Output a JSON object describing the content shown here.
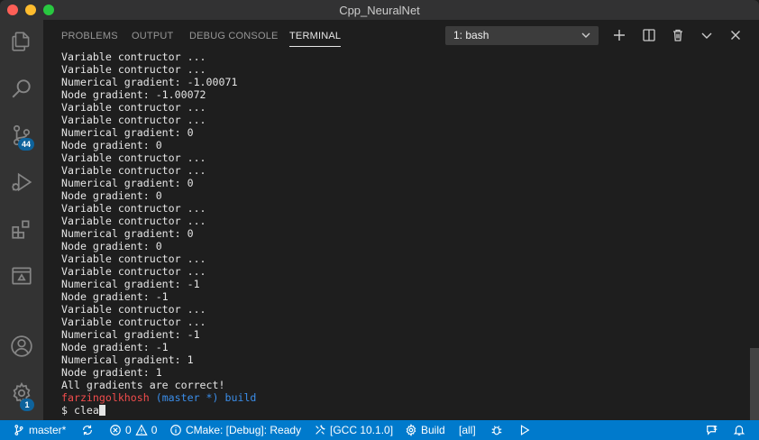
{
  "window": {
    "title": "Cpp_NeuralNet"
  },
  "activity_bar": {
    "items": [
      {
        "icon": "files-icon"
      },
      {
        "icon": "search-icon"
      },
      {
        "icon": "source-control-icon",
        "badge": "44"
      },
      {
        "icon": "run-debug-icon"
      },
      {
        "icon": "extensions-icon"
      },
      {
        "icon": "remote-explorer-icon"
      },
      {
        "icon": "account-icon"
      },
      {
        "icon": "settings-gear-icon",
        "badge": "1"
      }
    ]
  },
  "panel": {
    "tabs": [
      {
        "label": "PROBLEMS",
        "active": false
      },
      {
        "label": "OUTPUT",
        "active": false
      },
      {
        "label": "DEBUG CONSOLE",
        "active": false
      },
      {
        "label": "TERMINAL",
        "active": true
      }
    ],
    "terminal_select": "1: bash",
    "actions": [
      "new-terminal-icon",
      "split-terminal-icon",
      "trash-icon",
      "chevron-down-icon",
      "close-icon"
    ]
  },
  "terminal": {
    "lines": [
      "Variable contructor ...",
      "Variable contructor ...",
      "Numerical gradient: -1.00071",
      "Node gradient: -1.00072",
      "Variable contructor ...",
      "Variable contructor ...",
      "Numerical gradient: 0",
      "Node gradient: 0",
      "Variable contructor ...",
      "Variable contructor ...",
      "Numerical gradient: 0",
      "Node gradient: 0",
      "Variable contructor ...",
      "Variable contructor ...",
      "Numerical gradient: 0",
      "Node gradient: 0",
      "Variable contructor ...",
      "Variable contructor ...",
      "Numerical gradient: -1",
      "Node gradient: -1",
      "Variable contructor ...",
      "Variable contructor ...",
      "Numerical gradient: -1",
      "Node gradient: -1",
      "Numerical gradient: 1",
      "Node gradient: 1",
      "All gradients are correct!"
    ],
    "prompt": {
      "user": "farzingolkhosh",
      "branch": "(master *)",
      "dir": "build"
    },
    "input": "$ clea"
  },
  "status_bar": {
    "branch": "master*",
    "errors": "0",
    "warnings": "0",
    "cmake": "CMake: [Debug]: Ready",
    "kit": "[GCC 10.1.0]",
    "build": "Build",
    "target": "[all]"
  }
}
